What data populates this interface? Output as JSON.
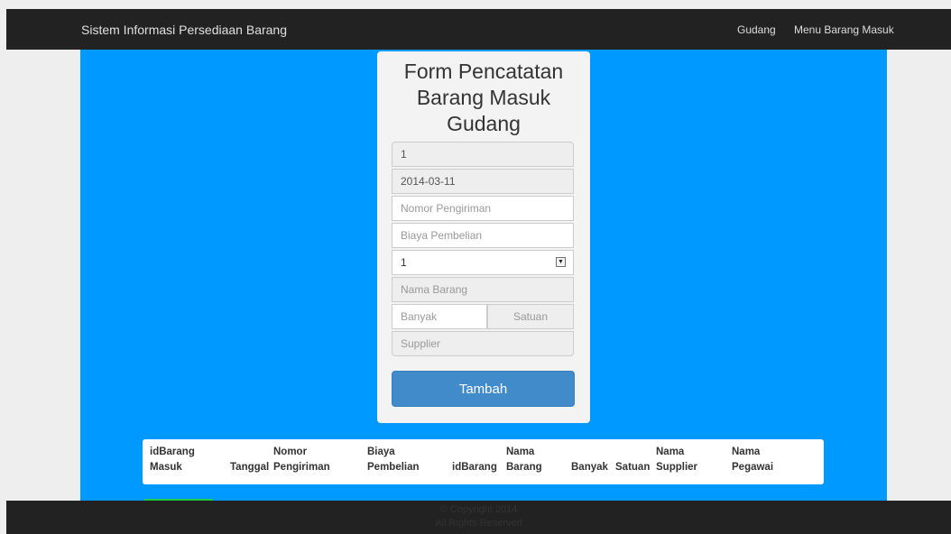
{
  "navbar": {
    "brand": "Sistem Informasi Persediaan Barang",
    "links": [
      "Gudang",
      "Menu Barang Masuk"
    ]
  },
  "form": {
    "title_lines": [
      "Form Pencatatan",
      "Barang Masuk",
      "Gudang"
    ],
    "fields": {
      "id_value": "1",
      "tanggal_value": "2014-03-11",
      "nomor_pengiriman_placeholder": "Nomor Pengiriman",
      "biaya_pembelian_placeholder": "Biaya Pembelian",
      "id_barang_selected": "1",
      "nama_barang_placeholder": "Nama Barang",
      "banyak_placeholder": "Banyak",
      "satuan_placeholder": "Satuan",
      "supplier_placeholder": "Supplier"
    },
    "submit_label": "Tambah"
  },
  "table": {
    "headers": [
      [
        "idBarang",
        "Masuk"
      ],
      [
        "",
        "Tanggal"
      ],
      [
        "Nomor",
        "Pengiriman"
      ],
      [
        "Biaya",
        "Pembelian"
      ],
      [
        "",
        "idBarang"
      ],
      [
        "Nama",
        "Barang"
      ],
      [
        "",
        "Banyak"
      ],
      [
        "",
        "Satuan"
      ],
      [
        "Nama",
        "Supplier"
      ],
      [
        "Nama",
        "Pegawai"
      ]
    ]
  },
  "footer": {
    "line1": "© Copyright 2014",
    "line2": "All Rights Reserved"
  },
  "colors": {
    "navbar": "#222222",
    "content_background": "#0099ff",
    "primary_button": "#428bca"
  }
}
